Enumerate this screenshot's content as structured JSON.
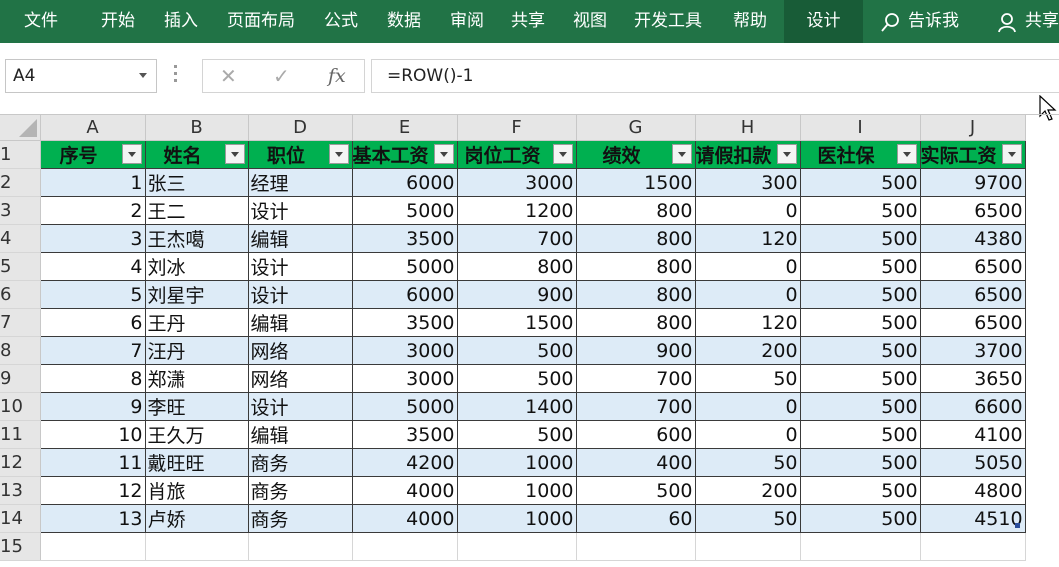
{
  "ribbon": {
    "tabs": [
      "文件",
      "开始",
      "插入",
      "页面布局",
      "公式",
      "数据",
      "审阅",
      "共享",
      "视图",
      "开发工具",
      "帮助",
      "设计"
    ],
    "active_tab": "设计",
    "tell_me": "告诉我",
    "share": "共享",
    "tell_me_icon": "lightbulb-search-icon",
    "share_icon": "person-icon",
    "colors": {
      "ribbon": "#217346",
      "active": "#185c37"
    }
  },
  "formula_bar": {
    "name_box": "A4",
    "formula": "=ROW()-1",
    "cancel_icon": "✕",
    "enter_icon": "✓",
    "function_icon": "fx"
  },
  "sheet": {
    "columns": [
      "A",
      "B",
      "D",
      "E",
      "F",
      "G",
      "H",
      "I",
      "J"
    ],
    "row_numbers": [
      "1",
      "2",
      "3",
      "4",
      "5",
      "6",
      "7",
      "8",
      "9",
      "10",
      "11",
      "12",
      "13",
      "14",
      "15"
    ],
    "headers": [
      "序号",
      "姓名",
      "职位",
      "基本工资",
      "岗位工资",
      "绩效",
      "请假扣款",
      "医社保",
      "实际工资"
    ],
    "rows": [
      [
        "1",
        "张三",
        "经理",
        "6000",
        "3000",
        "1500",
        "300",
        "500",
        "9700"
      ],
      [
        "2",
        "王二",
        "设计",
        "5000",
        "1200",
        "800",
        "0",
        "500",
        "6500"
      ],
      [
        "3",
        "王杰噶",
        "编辑",
        "3500",
        "700",
        "800",
        "120",
        "500",
        "4380"
      ],
      [
        "4",
        "刘冰",
        "设计",
        "5000",
        "800",
        "800",
        "0",
        "500",
        "6500"
      ],
      [
        "5",
        "刘星宇",
        "设计",
        "6000",
        "900",
        "800",
        "0",
        "500",
        "6500"
      ],
      [
        "6",
        "王丹",
        "编辑",
        "3500",
        "1500",
        "800",
        "120",
        "500",
        "6500"
      ],
      [
        "7",
        "汪丹",
        "网络",
        "3000",
        "500",
        "900",
        "200",
        "500",
        "3700"
      ],
      [
        "8",
        "郑潇",
        "网络",
        "3000",
        "500",
        "700",
        "50",
        "500",
        "3650"
      ],
      [
        "9",
        "李旺",
        "设计",
        "5000",
        "1400",
        "700",
        "0",
        "500",
        "6600"
      ],
      [
        "10",
        "王久万",
        "编辑",
        "3500",
        "500",
        "600",
        "0",
        "500",
        "4100"
      ],
      [
        "11",
        "戴旺旺",
        "商务",
        "4200",
        "1000",
        "400",
        "50",
        "500",
        "5050"
      ],
      [
        "12",
        "肖旅",
        "商务",
        "4000",
        "1000",
        "500",
        "200",
        "500",
        "4800"
      ],
      [
        "13",
        "卢娇",
        "商务",
        "4000",
        "1000",
        "60",
        "50",
        "500",
        "4510"
      ]
    ],
    "colors": {
      "header_fill": "#00b050",
      "band_fill": "#ddebf7",
      "grid_header": "#e6e6e6"
    }
  }
}
